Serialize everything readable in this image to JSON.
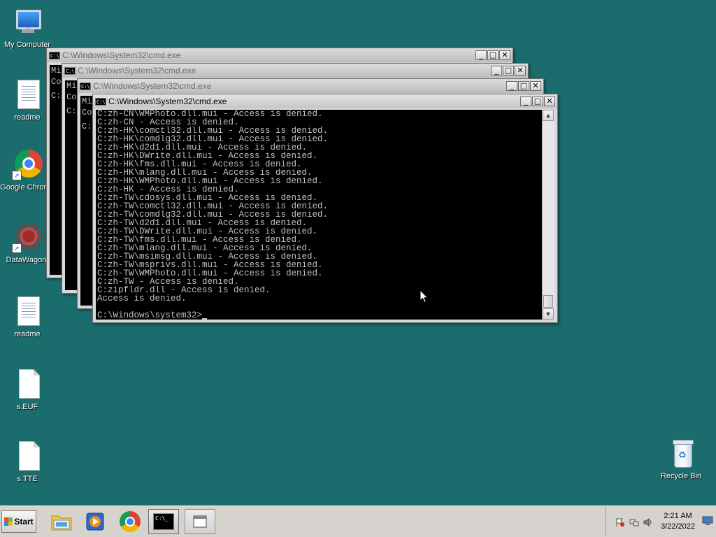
{
  "desktop": {
    "icons": [
      {
        "label": "My Computer",
        "icon": "computer-icon"
      },
      {
        "label": "readme",
        "icon": "text-document-icon"
      },
      {
        "label": "Google Chrome",
        "icon": "chrome-icon"
      },
      {
        "label": "DataWagon.",
        "icon": "datawagon-icon"
      },
      {
        "label": "readme",
        "icon": "text-document-icon"
      },
      {
        "label": "s.EUF",
        "icon": "file-icon"
      },
      {
        "label": "s.TTE",
        "icon": "file-icon"
      },
      {
        "label": "Recycle Bin",
        "icon": "recycle-bin-icon"
      }
    ]
  },
  "windows": {
    "back_title": "C:\\Windows\\System32\\cmd.exe",
    "back_peek": [
      "Mi",
      "Co",
      "",
      "C:"
    ],
    "active_title": "C:\\Windows\\System32\\cmd.exe",
    "controls": {
      "minimize": "_",
      "maximize": "□",
      "close": "✕"
    }
  },
  "console": {
    "lines": [
      "C:zh-CN\\WMPhoto.dll.mui - Access is denied.",
      "C:zh-CN - Access is denied.",
      "C:zh-HK\\comctl32.dll.mui - Access is denied.",
      "C:zh-HK\\comdlg32.dll.mui - Access is denied.",
      "C:zh-HK\\d2d1.dll.mui - Access is denied.",
      "C:zh-HK\\DWrite.dll.mui - Access is denied.",
      "C:zh-HK\\fms.dll.mui - Access is denied.",
      "C:zh-HK\\mlang.dll.mui - Access is denied.",
      "C:zh-HK\\WMPhoto.dll.mui - Access is denied.",
      "C:zh-HK - Access is denied.",
      "C:zh-TW\\cdosys.dll.mui - Access is denied.",
      "C:zh-TW\\comctl32.dll.mui - Access is denied.",
      "C:zh-TW\\comdlg32.dll.mui - Access is denied.",
      "C:zh-TW\\d2d1.dll.mui - Access is denied.",
      "C:zh-TW\\DWrite.dll.mui - Access is denied.",
      "C:zh-TW\\fms.dll.mui - Access is denied.",
      "C:zh-TW\\mlang.dll.mui - Access is denied.",
      "C:zh-TW\\msimsg.dll.mui - Access is denied.",
      "C:zh-TW\\msprivs.dll.mui - Access is denied.",
      "C:zh-TW\\WMPhoto.dll.mui - Access is denied.",
      "C:zh-TW - Access is denied.",
      "C:zipfldr.dll - Access is denied.",
      "Access is denied.",
      "",
      "C:\\Windows\\system32>"
    ]
  },
  "taskbar": {
    "start_label": "Start",
    "clock_time": "2:21 AM",
    "clock_date": "3/22/2022"
  }
}
